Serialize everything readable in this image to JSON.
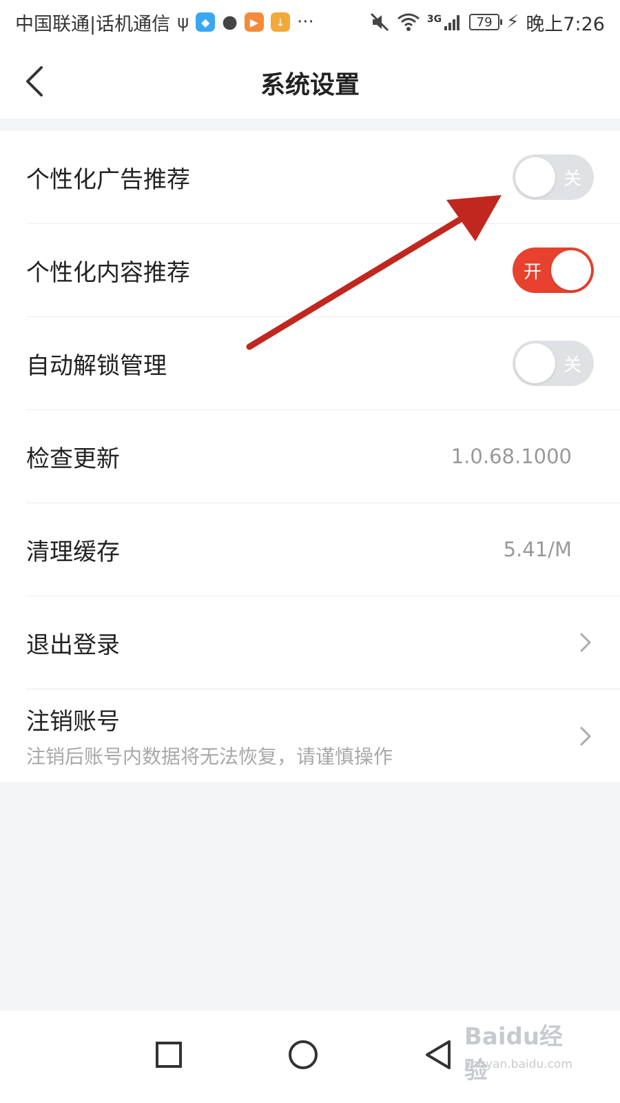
{
  "status_bar": {
    "carrier": "中国联通|话机通信",
    "network": "3G",
    "battery": "79",
    "time": "晚上7:26"
  },
  "header": {
    "title": "系统设置"
  },
  "settings": {
    "ad_recommend": {
      "label": "个性化广告推荐",
      "toggle_text": "关",
      "enabled": false
    },
    "content_recommend": {
      "label": "个性化内容推荐",
      "toggle_text": "开",
      "enabled": true
    },
    "auto_unlock": {
      "label": "自动解锁管理",
      "toggle_text": "关",
      "enabled": false
    },
    "check_update": {
      "label": "检查更新",
      "value": "1.0.68.1000"
    },
    "clear_cache": {
      "label": "清理缓存",
      "value": "5.41/M"
    },
    "logout": {
      "label": "退出登录"
    },
    "cancel_account": {
      "label": "注销账号",
      "sublabel": "注销后账号内数据将无法恢复，请谨慎操作"
    }
  },
  "watermark": {
    "main": "Baidu经验",
    "sub": "jingyan.baidu.com"
  },
  "colors": {
    "accent_on": "#e8412e",
    "toggle_off": "#dfe1e4",
    "annotation_arrow": "#c0281f"
  }
}
